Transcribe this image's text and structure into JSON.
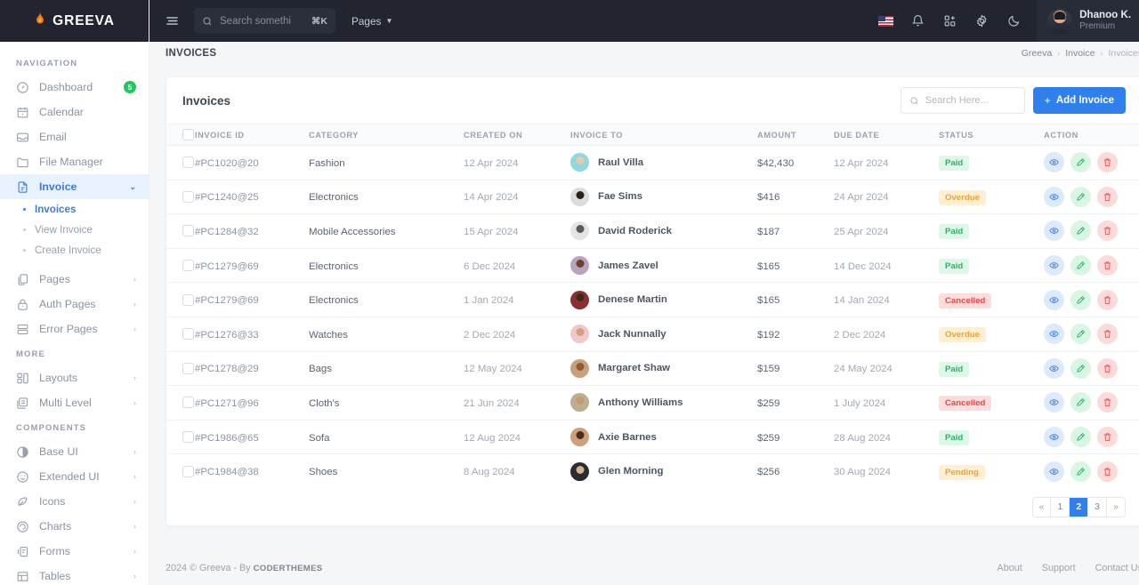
{
  "brand": {
    "name": "GREEVA",
    "flame": "🔥"
  },
  "topbar": {
    "search_placeholder": "Search something..",
    "search_value": "",
    "shortcut": "⌘K",
    "pages_label": "Pages",
    "user": {
      "name": "Dhanoo K.",
      "role": "Premium"
    }
  },
  "pagehead": {
    "title": "INVOICES",
    "breadcrumb": {
      "root": "Greeva",
      "parent": "Invoice",
      "current": "Invoices",
      "separator": "›"
    }
  },
  "sidebar": {
    "sections": [
      {
        "title": "NAVIGATION"
      },
      {
        "title": "MORE"
      },
      {
        "title": "COMPONENTS"
      }
    ],
    "nav": [
      {
        "label": "Dashboard",
        "icon": "gauge-icon",
        "badge": "5"
      },
      {
        "label": "Calendar",
        "icon": "calendar-icon"
      },
      {
        "label": "Email",
        "icon": "envelope-icon"
      },
      {
        "label": "File Manager",
        "icon": "folder-icon"
      },
      {
        "label": "Invoice",
        "icon": "document-icon",
        "active": true,
        "chevron": "⌄"
      }
    ],
    "invoice_sub": [
      {
        "label": "Invoices",
        "active": true
      },
      {
        "label": "View Invoice"
      },
      {
        "label": "Create Invoice"
      }
    ],
    "nav_rest": [
      {
        "label": "Pages",
        "icon": "copy-icon",
        "chevron": "›"
      },
      {
        "label": "Auth Pages",
        "icon": "lock-icon",
        "chevron": "›"
      },
      {
        "label": "Error Pages",
        "icon": "server-icon",
        "chevron": "›"
      }
    ],
    "more": [
      {
        "label": "Layouts",
        "icon": "layout-icon",
        "chevron": "›"
      },
      {
        "label": "Multi Level",
        "icon": "multilevel-icon",
        "chevron": "›"
      }
    ],
    "components": [
      {
        "label": "Base UI",
        "icon": "circle-half-icon",
        "chevron": "›"
      },
      {
        "label": "Extended UI",
        "icon": "smiley-icon",
        "chevron": "›"
      },
      {
        "label": "Icons",
        "icon": "leaf-icon",
        "chevron": "›"
      },
      {
        "label": "Charts",
        "icon": "spiral-icon",
        "chevron": "›"
      },
      {
        "label": "Forms",
        "icon": "form-icon",
        "chevron": "›"
      },
      {
        "label": "Tables",
        "icon": "table-icon",
        "chevron": "›"
      }
    ]
  },
  "card": {
    "title": "Invoices",
    "search_placeholder": "Search Here...",
    "search_value": "",
    "add_button": "Add Invoice",
    "add_button_plus": "+"
  },
  "table": {
    "columns": [
      "INVOICE ID",
      "CATEGORY",
      "CREATED ON",
      "INVOICE TO",
      "AMOUNT",
      "DUE DATE",
      "STATUS",
      "ACTION"
    ],
    "rows": [
      {
        "id": "#PC1020@20",
        "category": "Fashion",
        "created": "12 Apr 2024",
        "to": "Raul Villa",
        "amount": "$42,430",
        "due": "12 Apr 2024",
        "status": "Paid",
        "status_key": "paid",
        "av_head": "#e8c9a8",
        "av_body": "#8fd8e0"
      },
      {
        "id": "#PC1240@25",
        "category": "Electronics",
        "created": "14 Apr 2024",
        "to": "Fae Sims",
        "amount": "$416",
        "due": "24 Apr 2024",
        "status": "Overdue",
        "status_key": "overdue",
        "av_head": "#2a2118",
        "av_body": "#dcdcdc"
      },
      {
        "id": "#PC1284@32",
        "category": "Mobile Accessories",
        "created": "15 Apr 2024",
        "to": "David Roderick",
        "amount": "$187",
        "due": "25 Apr 2024",
        "status": "Paid",
        "status_key": "paid",
        "av_head": "#5a5a5a",
        "av_body": "#e4e4e4"
      },
      {
        "id": "#PC1279@69",
        "category": "Electronics",
        "created": "6 Dec 2024",
        "to": "James Zavel",
        "amount": "$165",
        "due": "14 Dec 2024",
        "status": "Paid",
        "status_key": "paid",
        "av_head": "#6b4226",
        "av_body": "#b9a3bd"
      },
      {
        "id": "#PC1279@69",
        "category": "Electronics",
        "created": "1 Jan 2024",
        "to": "Denese Martin",
        "amount": "$165",
        "due": "14 Jan 2024",
        "status": "Cancelled",
        "status_key": "cancelled",
        "av_head": "#3d2a1d",
        "av_body": "#8b2f33"
      },
      {
        "id": "#PC1276@33",
        "category": "Watches",
        "created": "2 Dec 2024",
        "to": "Jack Nunnally",
        "amount": "$192",
        "due": "2 Dec 2024",
        "status": "Overdue",
        "status_key": "overdue",
        "av_head": "#d3a07c",
        "av_body": "#f0c7cb"
      },
      {
        "id": "#PC1278@29",
        "category": "Bags",
        "created": "12 May 2024",
        "to": "Margaret Shaw",
        "amount": "$159",
        "due": "24 May 2024",
        "status": "Paid",
        "status_key": "paid",
        "av_head": "#8a5c3a",
        "av_body": "#c8a07a"
      },
      {
        "id": "#PC1271@96",
        "category": "Cloth's",
        "created": "21 Jun 2024",
        "to": "Anthony Williams",
        "amount": "$259",
        "due": "1 July 2024",
        "status": "Cancelled",
        "status_key": "cancelled",
        "av_head": "#c89a72",
        "av_body": "#bcae91"
      },
      {
        "id": "#PC1986@65",
        "category": "Sofa",
        "created": "12 Aug 2024",
        "to": "Axie Barnes",
        "amount": "$259",
        "due": "28 Aug 2024",
        "status": "Paid",
        "status_key": "paid",
        "av_head": "#4a2d1e",
        "av_body": "#cf9e7c"
      },
      {
        "id": "#PC1984@38",
        "category": "Shoes",
        "created": "8 Aug 2024",
        "to": "Glen Morning",
        "amount": "$256",
        "due": "30 Aug 2024",
        "status": "Pending",
        "status_key": "pending",
        "av_head": "#d9b08c",
        "av_body": "#2b2b33"
      }
    ],
    "actions": {
      "view": "view-icon",
      "edit": "edit-icon",
      "delete": "delete-icon"
    }
  },
  "pagination": {
    "prev": "«",
    "next": "»",
    "pages": [
      "1",
      "2",
      "3"
    ],
    "active": "2"
  },
  "footer": {
    "copyright": "2024 © Greeva - By ",
    "author": "CODERTHEMES",
    "links": [
      "About",
      "Support",
      "Contact Us"
    ]
  },
  "colors": {
    "accent": "#2f80ed",
    "dark": "#22252f",
    "paid": "#28b463",
    "overdue": "#e8a33d",
    "cancelled": "#ef4444",
    "pending": "#e8a33d",
    "badge_green": "#22c55e"
  }
}
